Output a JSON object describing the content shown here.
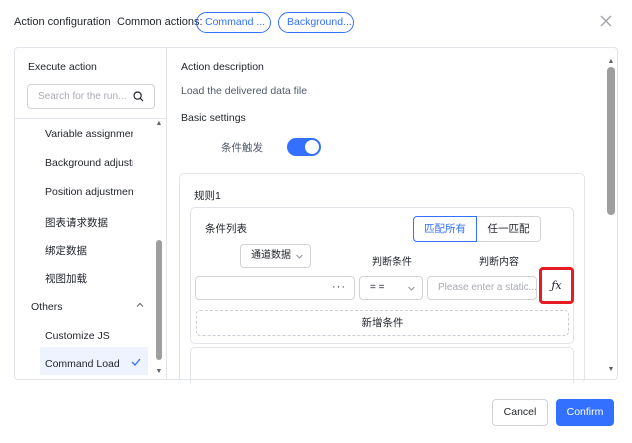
{
  "header": {
    "title": "Action configuration",
    "common_actions_label": "Common actions:",
    "common_actions": [
      "Command ...",
      "Background..."
    ],
    "close_icon": "close-icon"
  },
  "sidebar": {
    "title": "Execute action",
    "search_placeholder": "Search for the run...",
    "items": [
      {
        "label": "Variable assignment"
      },
      {
        "label": "Background adjustm"
      },
      {
        "label": "Position adjustment"
      },
      {
        "label": "图表请求数据"
      },
      {
        "label": "绑定数据"
      },
      {
        "label": "视图加载"
      }
    ],
    "group": {
      "label": "Others",
      "expanded": true
    },
    "group_items": [
      {
        "label": "Customize JS",
        "selected": false
      },
      {
        "label": "Command Load",
        "selected": true
      }
    ]
  },
  "detail": {
    "action_description_label": "Action description",
    "action_description_value": "Load the delivered data file",
    "basic_settings_label": "Basic settings",
    "condition_trigger_label": "条件触发",
    "condition_trigger_on": true,
    "rule_title": "规则1",
    "condition_list_label": "条件列表",
    "match_all_label": "匹配所有",
    "match_any_label": "任一匹配",
    "source_select_value": "通道数据",
    "judge_condition_label": "判断条件",
    "judge_content_label": "判断内容",
    "field_more_icon": "ellipsis-icon",
    "operator_value": "= =",
    "value_placeholder": "Please enter a static...",
    "fx_label": "ƒx",
    "add_condition_label": "新增条件"
  },
  "footer": {
    "cancel_label": "Cancel",
    "confirm_label": "Confirm"
  },
  "colors": {
    "accent": "#3370ff",
    "highlight_border": "#e51c23"
  }
}
